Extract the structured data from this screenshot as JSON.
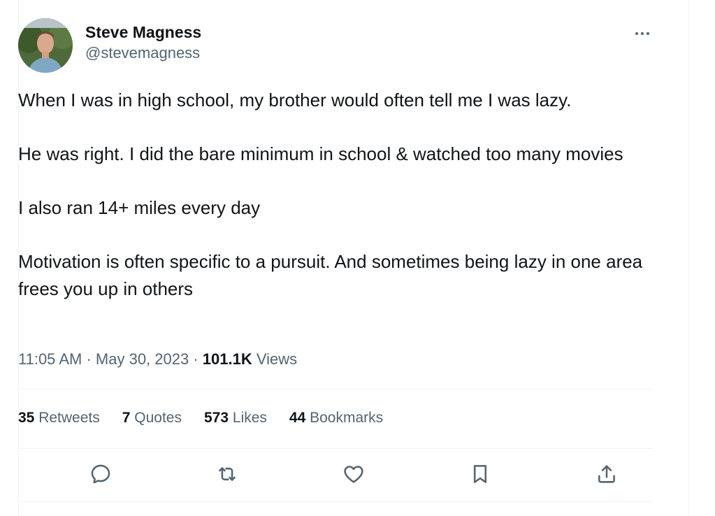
{
  "author": {
    "display_name": "Steve Magness",
    "handle": "@stevemagness"
  },
  "tweet": {
    "paragraphs": [
      "When I was in high school, my brother would often tell me I was lazy.",
      "He was right. I did the bare minimum in school & watched too many movies",
      "I also ran 14+ miles every day",
      "Motivation is often specific to a pursuit. And sometimes being lazy in one area frees you up in others"
    ],
    "time": "11:05 AM",
    "separator": "·",
    "date": "May 30, 2023",
    "views_count": "101.1K",
    "views_label": "Views"
  },
  "stats": {
    "retweets_count": "35",
    "retweets_label": "Retweets",
    "quotes_count": "7",
    "quotes_label": "Quotes",
    "likes_count": "573",
    "likes_label": "Likes",
    "bookmarks_count": "44",
    "bookmarks_label": "Bookmarks"
  },
  "icons": {
    "more": "more-horizontal-icon",
    "reply": "reply-icon",
    "retweet": "retweet-icon",
    "like": "heart-icon",
    "bookmark": "bookmark-icon",
    "share": "share-icon"
  },
  "colors": {
    "text_primary": "#0f1419",
    "text_secondary": "#536471",
    "divider": "#eff3f4"
  }
}
